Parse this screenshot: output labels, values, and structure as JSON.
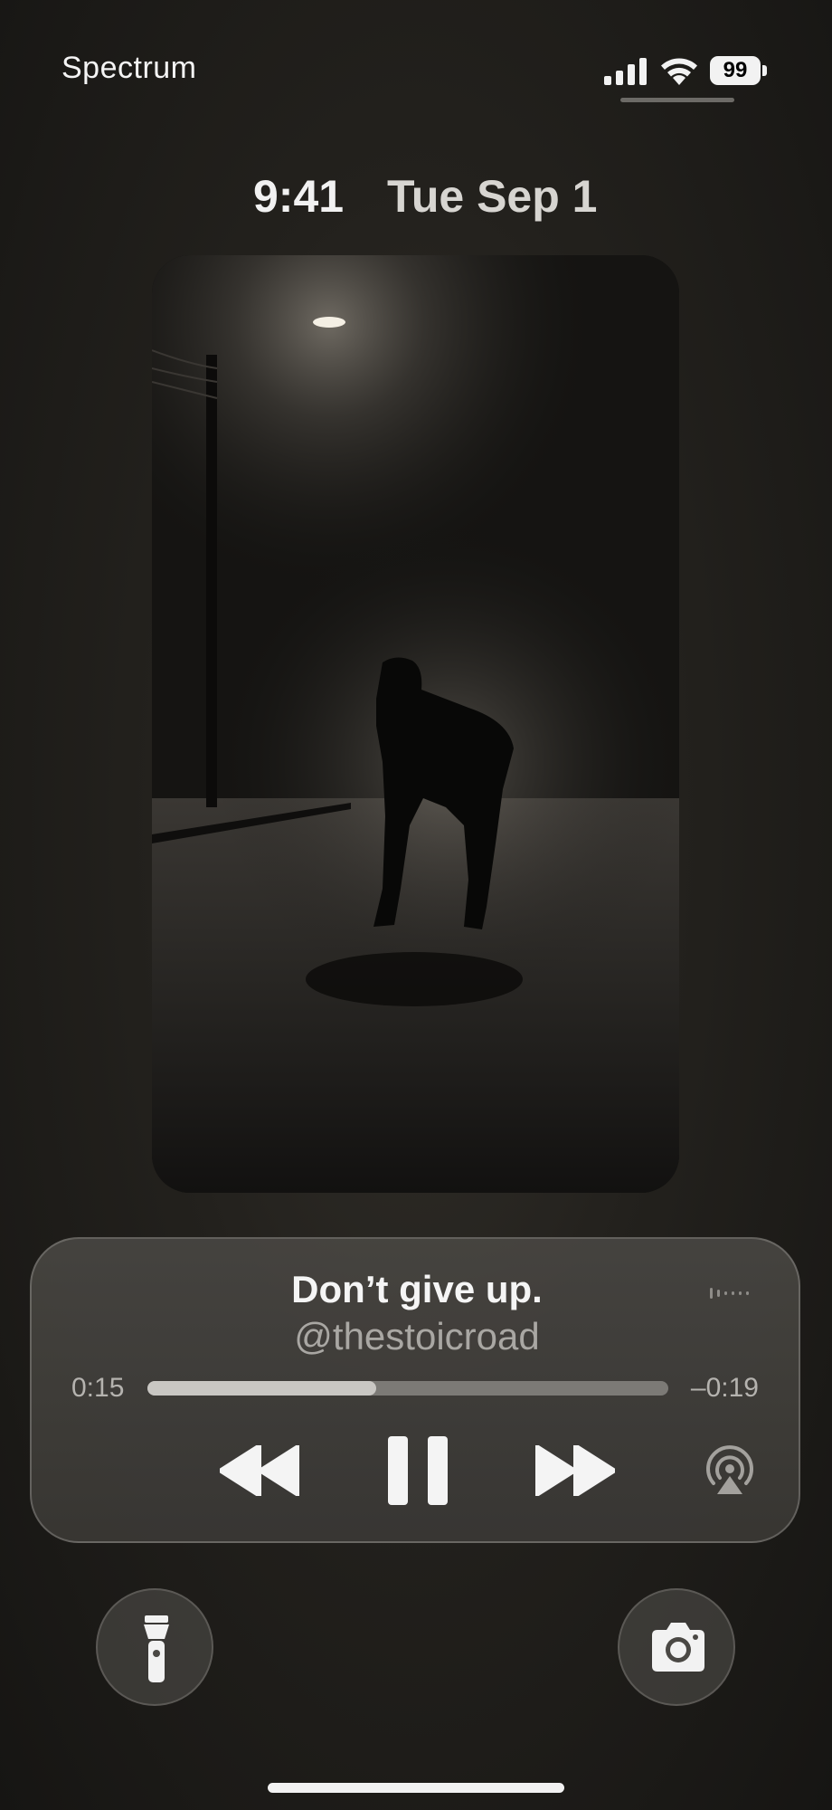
{
  "status_bar": {
    "carrier": "Spectrum",
    "battery_level": "99",
    "icons": [
      "cellular-signal-icon",
      "wifi-icon",
      "battery-icon"
    ]
  },
  "lock_screen": {
    "time": "9:41",
    "date": "Tue Sep 1"
  },
  "now_playing": {
    "title": "Don’t give up.",
    "artist": "@thestoicroad",
    "elapsed": "0:15",
    "remaining": "–0:19",
    "progress": 0.44,
    "controls": [
      "rewind-icon",
      "pause-icon",
      "fast-forward-icon",
      "airplay-icon"
    ],
    "artwork_icon": "now-playing-artwork"
  },
  "quick_actions": {
    "left": "flashlight-icon",
    "right": "camera-icon"
  },
  "colors": {
    "background": "#23211d",
    "player_background": "#3c3a37",
    "progress_fill": "#c9c7c3",
    "progress_track": "#7c7a76"
  }
}
